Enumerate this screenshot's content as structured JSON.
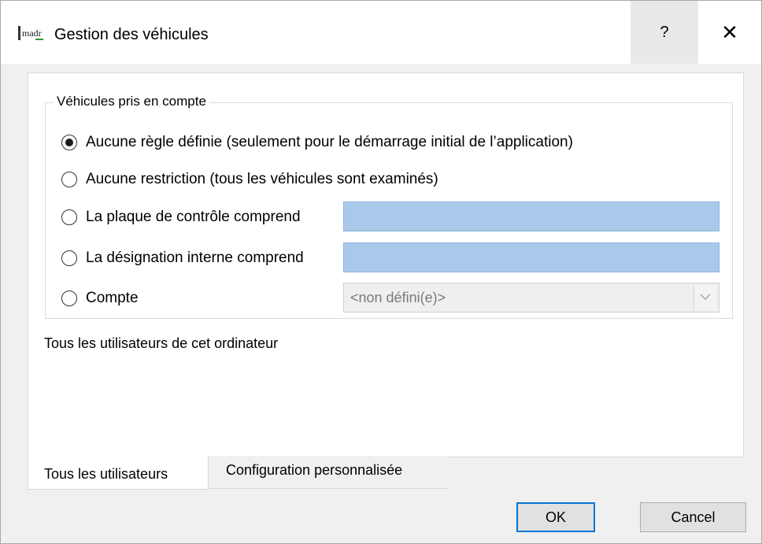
{
  "window": {
    "title": "Gestion des véhicules",
    "help_label": "?",
    "close_label": "✕",
    "icon": "madr-app-icon"
  },
  "group": {
    "legend": "Véhicules pris en compte",
    "options": [
      {
        "label": "Aucune règle définie (seulement pour le démarrage initial de l’application)",
        "checked": true
      },
      {
        "label": "Aucune restriction (tous les véhicules sont examinés)",
        "checked": false
      },
      {
        "label": "La plaque de contrôle comprend",
        "checked": false
      },
      {
        "label": "La désignation interne comprend",
        "checked": false
      },
      {
        "label": "Compte",
        "checked": false
      }
    ],
    "plate_value": "",
    "designation_value": "",
    "account_value": "<non défini(e)>"
  },
  "scope_text": "Tous les utilisateurs de cet ordinateur",
  "tabs": [
    {
      "label": "Tous les utilisateurs",
      "active": true
    },
    {
      "label": "Configuration personnalisée",
      "active": false
    }
  ],
  "buttons": {
    "ok": "OK",
    "cancel": "Cancel"
  },
  "colors": {
    "field_bg": "#a9c8ea",
    "focus_border": "#0078d7"
  }
}
